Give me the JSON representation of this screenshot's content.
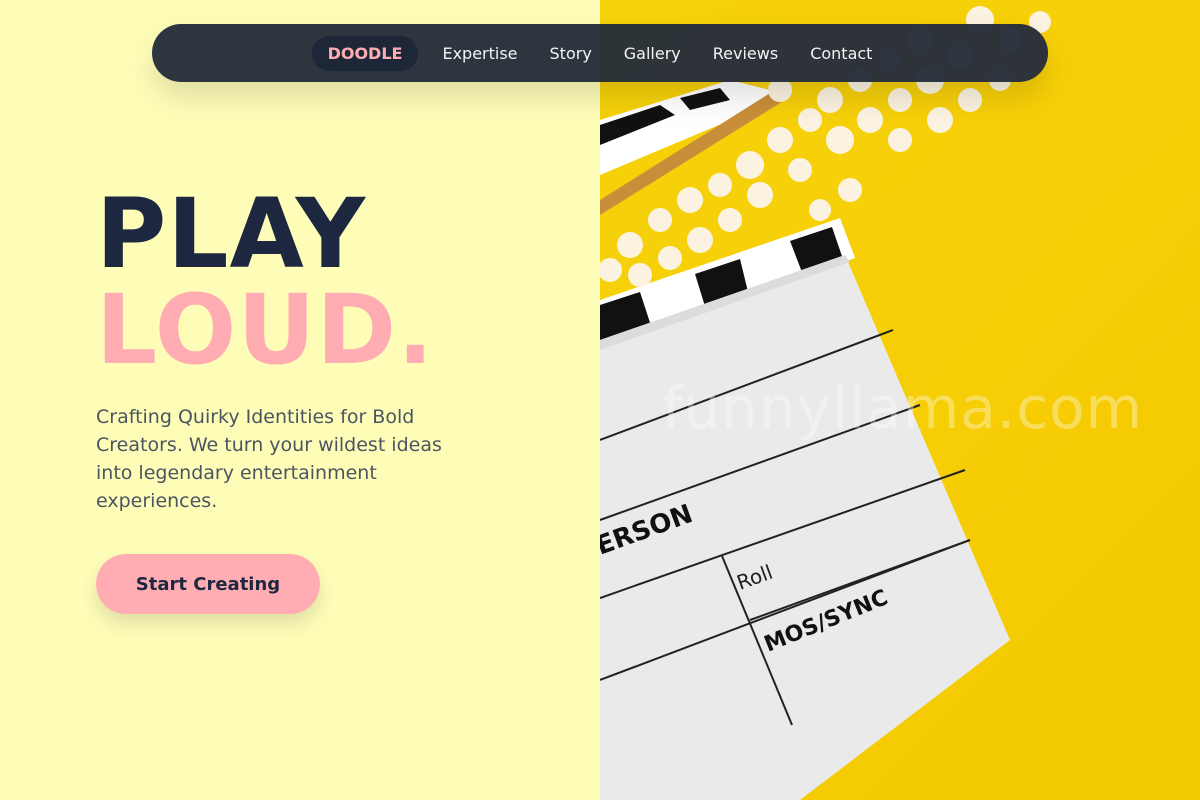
{
  "nav": {
    "logo": "DOODLE",
    "links": [
      "Expertise",
      "Story",
      "Gallery",
      "Reviews",
      "Contact"
    ]
  },
  "hero": {
    "title_line1": "PLAY",
    "title_line2": "LOUD.",
    "subtitle": "Crafting Quirky Identities for Bold Creators. We turn your wildest ideas into legendary entertainment experiences.",
    "cta_label": "Start Creating"
  },
  "image": {
    "watermark": "funnyllama.com",
    "clapper_text_1": "ERSON",
    "clapper_text_2": "Roll",
    "clapper_text_3": "MOS/SYNC"
  },
  "colors": {
    "background_left": "#fefdb8",
    "background_right": "#f5d20a",
    "nav_bg": "#242d3a",
    "accent_pink": "#ffadb3",
    "dark_navy": "#1d2740",
    "body_text": "#4b5561"
  }
}
